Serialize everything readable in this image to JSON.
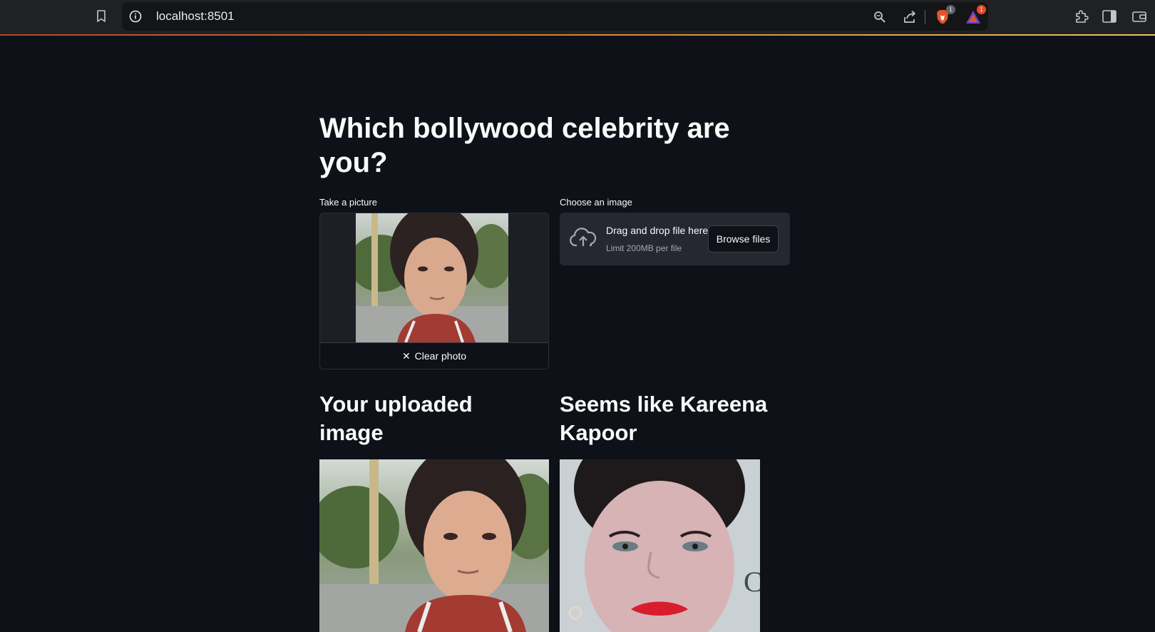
{
  "browser": {
    "url": "localhost:8501",
    "shields_badge": "1",
    "rewards_badge": "1"
  },
  "page": {
    "title": "Which bollywood celebrity are you?",
    "camera": {
      "label": "Take a picture",
      "clear_label": "Clear photo"
    },
    "uploader": {
      "label": "Choose an image",
      "drop_text": "Drag and drop file here",
      "limit_text": "Limit 200MB per file",
      "browse_label": "Browse files"
    },
    "result": {
      "uploaded_heading": "Your uploaded image",
      "match_heading": "Seems like Kareena Kapoor"
    }
  },
  "colors": {
    "background": "#0e1117",
    "widget_bg": "#262730",
    "chrome_bg": "#202124"
  }
}
